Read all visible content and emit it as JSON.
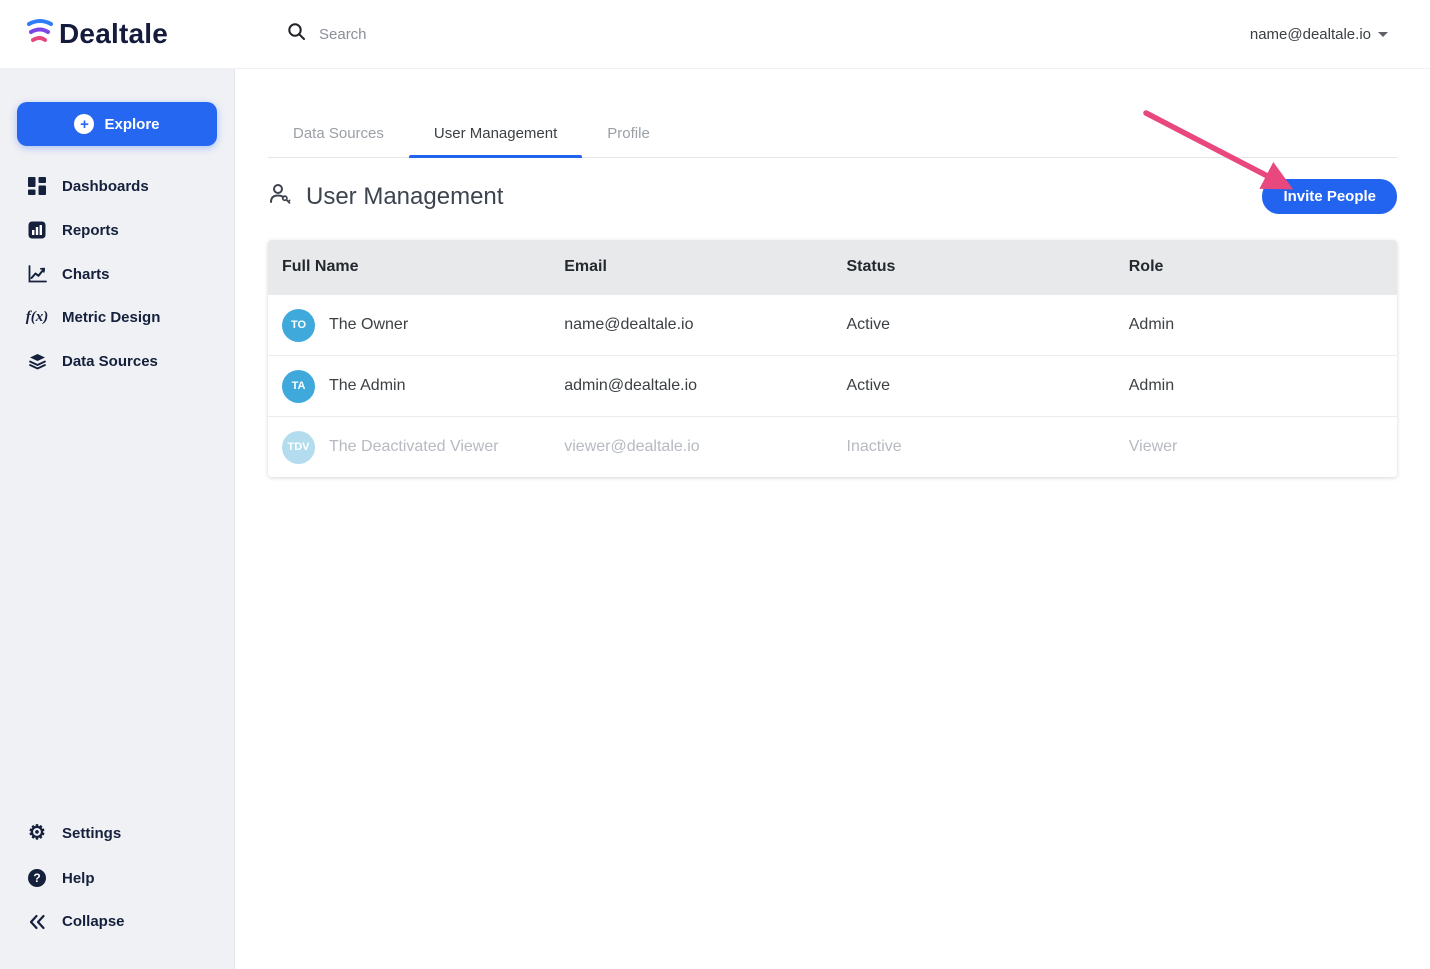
{
  "topbar": {
    "logo_text": "Dealtale",
    "search_placeholder": "Search",
    "account_email": "name@dealtale.io"
  },
  "sidebar": {
    "explore_label": "Explore",
    "plus_glyph": "+",
    "items": [
      {
        "label": "Dashboards"
      },
      {
        "label": "Reports"
      },
      {
        "label": "Charts"
      },
      {
        "label": "Metric Design",
        "icon_text": "f(x)"
      },
      {
        "label": "Data Sources"
      }
    ],
    "footer_items": [
      {
        "label": "Settings",
        "icon_glyph": "⚙"
      },
      {
        "label": "Help",
        "icon_glyph": "?"
      },
      {
        "label": "Collapse"
      }
    ]
  },
  "main": {
    "tabs": [
      {
        "label": "Data Sources",
        "active": false
      },
      {
        "label": "User Management",
        "active": true
      },
      {
        "label": "Profile",
        "active": false
      }
    ],
    "page_title": "User Management",
    "invite_button_label": "Invite People",
    "table": {
      "columns": [
        "Full Name",
        "Email",
        "Status",
        "Role"
      ],
      "rows": [
        {
          "initials": "TO",
          "name": "The Owner",
          "email": "name@dealtale.io",
          "status": "Active",
          "role": "Admin",
          "inactive": false
        },
        {
          "initials": "TA",
          "name": "The Admin",
          "email": "admin@dealtale.io",
          "status": "Active",
          "role": "Admin",
          "inactive": false
        },
        {
          "initials": "TDV",
          "name": "The Deactivated Viewer",
          "email": "viewer@dealtale.io",
          "status": "Inactive",
          "role": "Viewer",
          "inactive": true
        }
      ]
    }
  },
  "colors": {
    "accent_blue": "#2264f0",
    "sidebar_button_blue": "#2667f2",
    "avatar_blue": "#3fa9dc",
    "annotation_pink": "#e8487e"
  }
}
